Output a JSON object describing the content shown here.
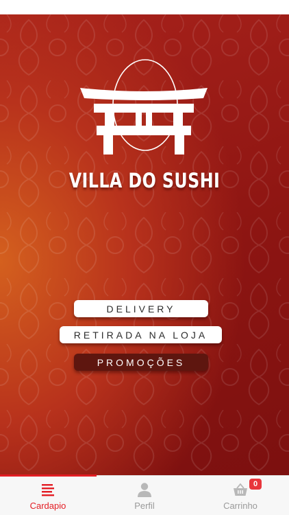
{
  "brand": {
    "name": "VILLA DO SUSHI",
    "logo_icon": "torii-gate-icon"
  },
  "colors": {
    "accent": "#e31c23",
    "hero_dark": "#8d1512",
    "hero_light": "#d4601e",
    "promo_button": "#5e160f"
  },
  "menu": {
    "delivery_label": "DELIVERY",
    "retirada_label": "RETIRADA NA LOJA",
    "promocoes_label": "PROMOÇÕES"
  },
  "tab_bar": {
    "tabs": [
      {
        "label": "Cardapio",
        "icon": "menu-list-icon",
        "active": true
      },
      {
        "label": "Perfil",
        "icon": "user-icon",
        "active": false
      },
      {
        "label": "Carrinho",
        "icon": "basket-icon",
        "active": false,
        "badge": "0"
      }
    ]
  }
}
